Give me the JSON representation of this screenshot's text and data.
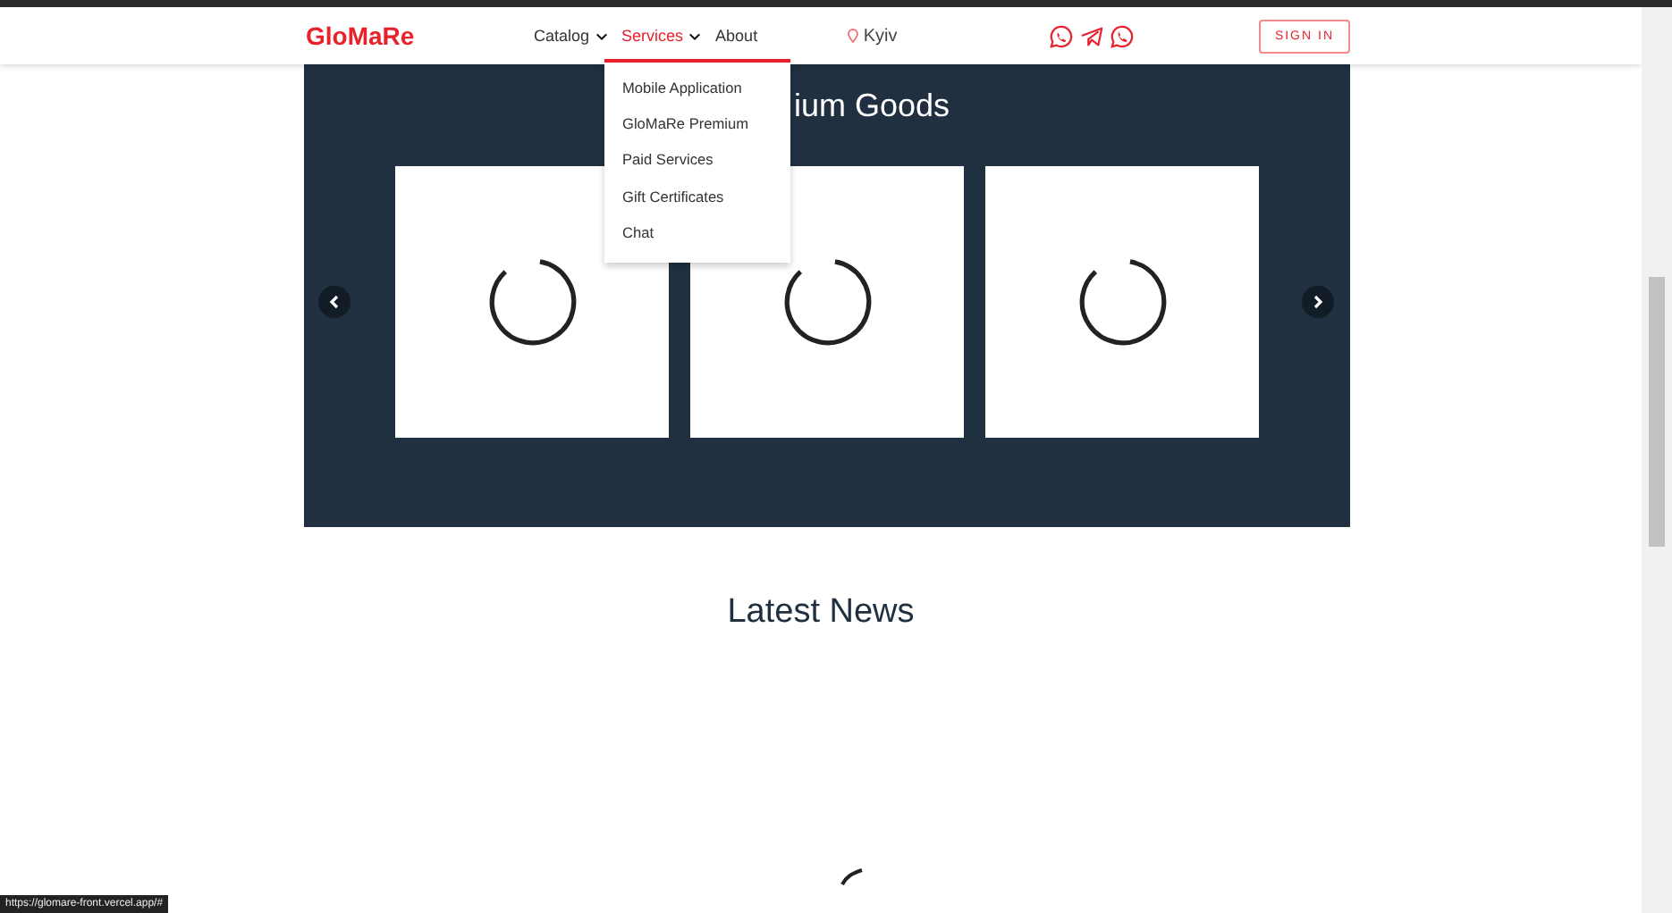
{
  "header": {
    "logo": "GloMaRe",
    "nav": [
      {
        "label": "Catalog",
        "selected": false,
        "dropdown": true
      },
      {
        "label": "Services",
        "selected": true,
        "dropdown": true
      },
      {
        "label": "About",
        "selected": false,
        "dropdown": false
      }
    ],
    "location": "Kyiv",
    "sign_in": "SIGN IN"
  },
  "services_menu": [
    "Mobile Application",
    "GloMaRe Premium",
    "Paid Services",
    "Gift Certificates",
    "Chat"
  ],
  "premium": {
    "title": "ium Goods",
    "cards": [
      {
        "kind": "loading"
      },
      {
        "kind": "loading"
      },
      {
        "kind": "loading"
      }
    ]
  },
  "news": {
    "title": "Latest News"
  },
  "status_url": "https://glomare-front.vercel.app/#"
}
